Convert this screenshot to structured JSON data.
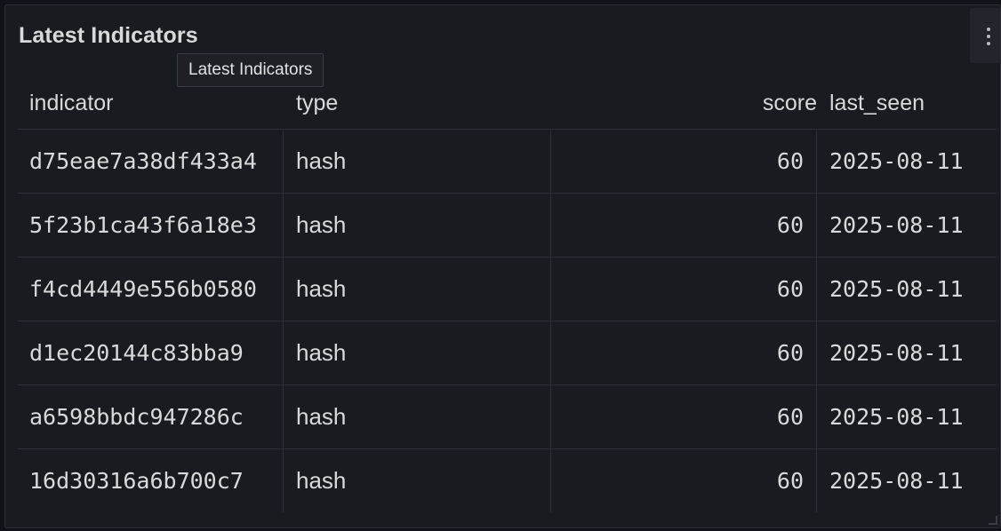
{
  "panel": {
    "title": "Latest Indicators",
    "tooltip": "Latest Indicators",
    "menu_icon": "kebab-vertical-icon"
  },
  "table": {
    "columns": [
      "indicator",
      "type",
      "score",
      "last_seen"
    ],
    "rows": [
      {
        "indicator": "d75eae7a38df433a4",
        "type": "hash",
        "score": "60",
        "last_seen": "2025-08-11"
      },
      {
        "indicator": "5f23b1ca43f6a18e3",
        "type": "hash",
        "score": "60",
        "last_seen": "2025-08-11"
      },
      {
        "indicator": "f4cd4449e556b0580",
        "type": "hash",
        "score": "60",
        "last_seen": "2025-08-11"
      },
      {
        "indicator": "d1ec20144c83bba9",
        "type": "hash",
        "score": "60",
        "last_seen": "2025-08-11"
      },
      {
        "indicator": "a6598bbdc947286c",
        "type": "hash",
        "score": "60",
        "last_seen": "2025-08-11"
      },
      {
        "indicator": "16d30316a6b700c7",
        "type": "hash",
        "score": "60",
        "last_seen": "2025-08-11"
      }
    ]
  },
  "colors": {
    "background": "#111217",
    "panel": "#181b1f",
    "border": "#2c2f35",
    "text": "#d8d9da"
  }
}
